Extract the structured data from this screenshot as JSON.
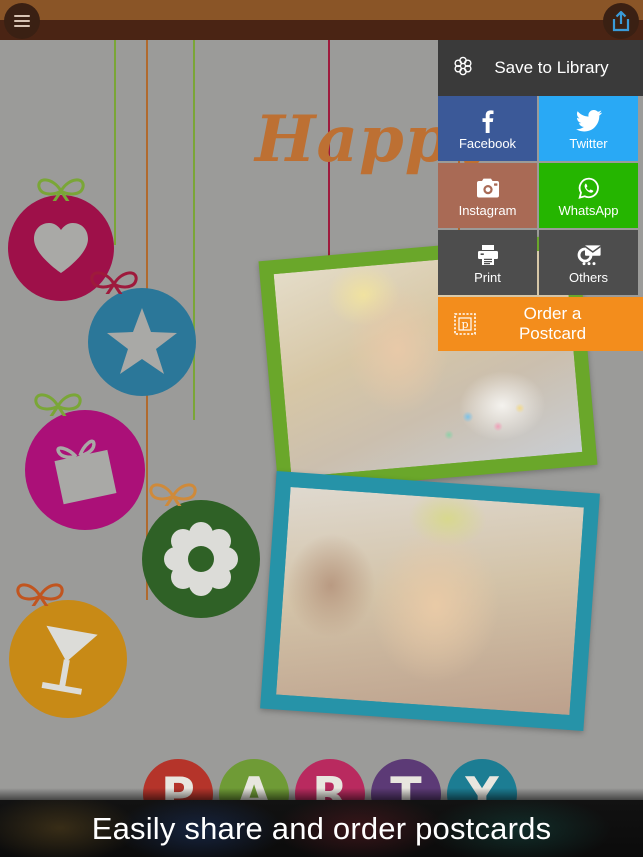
{
  "toolbar": {
    "menu_icon": "hamburger-menu-icon",
    "share_icon": "share-export-icon"
  },
  "share_panel": {
    "save": {
      "label": "Save to Library",
      "icon": "library-flower-icon",
      "bg": "#3a3a3a"
    },
    "tiles": [
      {
        "label": "Facebook",
        "icon": "facebook-icon",
        "bg": "#3b5998"
      },
      {
        "label": "Twitter",
        "icon": "twitter-bird-icon",
        "bg": "#29a9f5"
      },
      {
        "label": "Instagram",
        "icon": "instagram-camera-icon",
        "bg": "#a96a55"
      },
      {
        "label": "WhatsApp",
        "icon": "whatsapp-icon",
        "bg": "#25b500"
      },
      {
        "label": "Print",
        "icon": "printer-icon",
        "bg": "#4d4d4d"
      },
      {
        "label": "Others",
        "icon": "others-envelope-icon",
        "bg": "#4d4d4d"
      }
    ],
    "order": {
      "label": "Order a Postcard",
      "icon": "postcard-stamp-icon",
      "bg": "#f38d1c"
    }
  },
  "card": {
    "greeting": "Happy",
    "background": "#9b9b99",
    "party_letters": [
      {
        "char": "P",
        "color": "#b5342a"
      },
      {
        "char": "A",
        "color": "#6f9b36"
      },
      {
        "char": "R",
        "color": "#b92a5f"
      },
      {
        "char": "T",
        "color": "#5c3a76"
      },
      {
        "char": "Y",
        "color": "#1c7d93"
      }
    ],
    "ornaments": [
      {
        "symbol": "heart",
        "color": "#9e1049",
        "bow": "#7aa637"
      },
      {
        "symbol": "star",
        "color": "#2b7799",
        "bow": "#9e1a3c"
      },
      {
        "symbol": "gift",
        "color": "#ab1078",
        "bow": "#7aa637"
      },
      {
        "symbol": "flower",
        "color": "#2f6126",
        "bow": "#cf8a3a"
      },
      {
        "symbol": "cocktail",
        "color": "#c88a16",
        "bow": "#c1551f"
      }
    ],
    "photos": [
      {
        "frame_color": "#6aa72a",
        "caption": "girl-with-birthday-cake"
      },
      {
        "frame_color": "#2693a8",
        "caption": "smiling-girl-party-hat"
      }
    ]
  },
  "caption": {
    "text": "Easily share and order postcards"
  }
}
